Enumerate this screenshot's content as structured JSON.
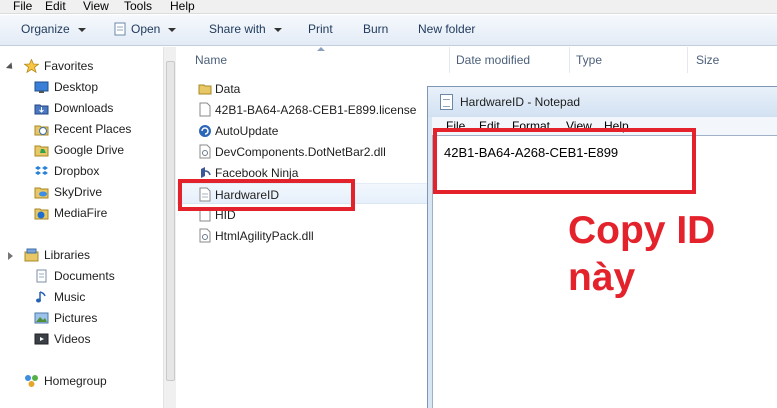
{
  "menubar": {
    "items": [
      "File",
      "Edit",
      "View",
      "Tools",
      "Help"
    ]
  },
  "toolbar": {
    "organize": "Organize",
    "open": "Open",
    "share": "Share with",
    "print": "Print",
    "burn": "Burn",
    "new_folder": "New folder"
  },
  "nav": {
    "favorites_label": "Favorites",
    "favorites": [
      {
        "label": "Desktop",
        "icon": "desktop-icon"
      },
      {
        "label": "Downloads",
        "icon": "downloads-icon"
      },
      {
        "label": "Recent Places",
        "icon": "recent-places-icon"
      },
      {
        "label": "Google Drive",
        "icon": "google-drive-icon"
      },
      {
        "label": "Dropbox",
        "icon": "dropbox-icon"
      },
      {
        "label": "SkyDrive",
        "icon": "skydrive-icon"
      },
      {
        "label": "MediaFire",
        "icon": "mediafire-icon"
      }
    ],
    "libraries_label": "Libraries",
    "libraries": [
      {
        "label": "Documents",
        "icon": "documents-icon"
      },
      {
        "label": "Music",
        "icon": "music-icon"
      },
      {
        "label": "Pictures",
        "icon": "pictures-icon"
      },
      {
        "label": "Videos",
        "icon": "videos-icon"
      }
    ],
    "homegroup_label": "Homegroup"
  },
  "columns": {
    "name": "Name",
    "date_modified": "Date modified",
    "type": "Type",
    "size": "Size"
  },
  "files": [
    {
      "name": "Data",
      "icon": "folder-icon"
    },
    {
      "name": "42B1-BA64-A268-CEB1-E899.license",
      "icon": "file-icon"
    },
    {
      "name": "AutoUpdate",
      "icon": "autoupdate-icon"
    },
    {
      "name": "DevComponents.DotNetBar2.dll",
      "icon": "dll-icon"
    },
    {
      "name": "Facebook Ninja",
      "icon": "shortcut-icon"
    },
    {
      "name": "HardwareID",
      "icon": "text-file-icon"
    },
    {
      "name": "HID",
      "icon": "file-icon"
    },
    {
      "name": "HtmlAgilityPack.dll",
      "icon": "dll-icon"
    }
  ],
  "notepad": {
    "title": "HardwareID - Notepad",
    "menu": [
      "File",
      "Edit",
      "Format",
      "View",
      "Help"
    ],
    "content": "42B1-BA64-A268-CEB1-E899"
  },
  "annotation": {
    "line1": "Copy ID",
    "line2": "này"
  },
  "colors": {
    "highlight": "#e3222b",
    "toolbar_text": "#1e395b"
  }
}
